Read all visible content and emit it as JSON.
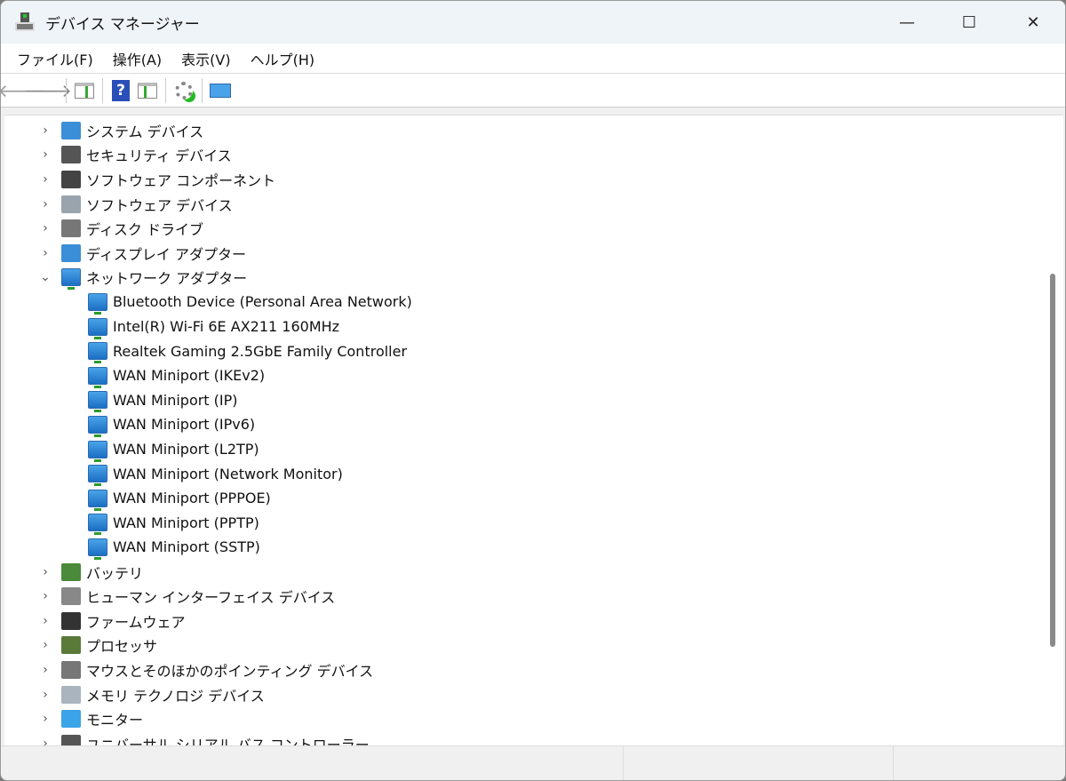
{
  "window": {
    "title": "デバイス マネージャー",
    "minimize": "—",
    "maximize": "☐",
    "close": "✕"
  },
  "menu": [
    "ファイル(F)",
    "操作(A)",
    "表示(V)",
    "ヘルプ(H)"
  ],
  "toolbar": {
    "back": "🡐",
    "forward": "🡒",
    "help": "?"
  },
  "tree": {
    "categories_before": [
      {
        "label": "システム デバイス",
        "color": "#3b8fd8"
      },
      {
        "label": "セキュリティ デバイス",
        "color": "#555555"
      },
      {
        "label": "ソフトウェア コンポーネント",
        "color": "#444444"
      },
      {
        "label": "ソフトウェア デバイス",
        "color": "#9aa4ad"
      },
      {
        "label": "ディスク ドライブ",
        "color": "#777777"
      },
      {
        "label": "ディスプレイ アダプター",
        "color": "#3b8fd8"
      }
    ],
    "expanded": {
      "label": "ネットワーク アダプター",
      "children": [
        "Bluetooth Device (Personal Area Network)",
        "Intel(R) Wi-Fi 6E AX211 160MHz",
        "Realtek Gaming 2.5GbE Family Controller",
        "WAN Miniport (IKEv2)",
        "WAN Miniport (IP)",
        "WAN Miniport (IPv6)",
        "WAN Miniport (L2TP)",
        "WAN Miniport (Network Monitor)",
        "WAN Miniport (PPPOE)",
        "WAN Miniport (PPTP)",
        "WAN Miniport (SSTP)"
      ]
    },
    "categories_after": [
      {
        "label": "バッテリ",
        "color": "#4a8a3a"
      },
      {
        "label": "ヒューマン インターフェイス デバイス",
        "color": "#888888"
      },
      {
        "label": "ファームウェア",
        "color": "#333333"
      },
      {
        "label": "プロセッサ",
        "color": "#5a7a3a"
      },
      {
        "label": "マウスとそのほかのポインティング デバイス",
        "color": "#777777"
      },
      {
        "label": "メモリ テクノロジ デバイス",
        "color": "#aab4be"
      },
      {
        "label": "モニター",
        "color": "#3ba3e8"
      },
      {
        "label": "ユニバーサル シリアル バス コントローラー",
        "color": "#555555"
      }
    ]
  }
}
